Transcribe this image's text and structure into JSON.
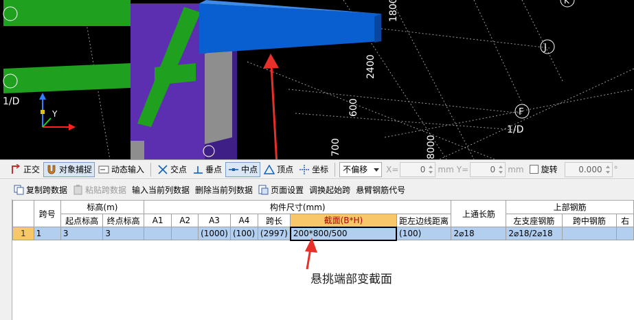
{
  "viewport": {
    "axis_labels": [
      "1/D",
      "1/D",
      "J",
      "F",
      "K"
    ],
    "dimension_labels": [
      "1800",
      "2400",
      "600",
      "700",
      "8000"
    ],
    "axis_letters": {
      "y": "Y"
    }
  },
  "snap_toolbar": {
    "ortho": "正交",
    "object_snap": "对象捕捉",
    "dynamic_input": "动态输入",
    "intersection": "交点",
    "perpendicular": "垂点",
    "midpoint": "中点",
    "vertex": "顶点",
    "coordinate": "坐标",
    "offset_value": "不偏移",
    "x_label": "X=",
    "x_value": "0",
    "x_unit": "mm",
    "y_label": "Y=",
    "y_value": "0",
    "y_unit": "mm",
    "rotate_label": "旋转",
    "rotate_value": "0.000",
    "degree": "°"
  },
  "grid_toolbar": {
    "copy_span": "复制跨数据",
    "paste_span": "粘贴跨数据",
    "input_column": "输入当前列数据",
    "delete_column": "删除当前列数据",
    "page_setup": "页面设置",
    "swap_start": "调换起始跨",
    "cantilever_code": "悬臂钢筋代号"
  },
  "table": {
    "headers": {
      "span_no": "跨号",
      "elevation": "标高(m)",
      "start_elev": "起点标高",
      "end_elev": "终点标高",
      "member_size": "构件尺寸(mm)",
      "a1": "A1",
      "a2": "A2",
      "a3": "A3",
      "a4": "A4",
      "span_len": "跨长",
      "section": "截面(B*H)",
      "dist_left": "距左边线距离",
      "top_through": "上通长筋",
      "top_rebar": "上部钢筋",
      "left_support": "左支座钢筋",
      "mid_span": "跨中钢筋",
      "right": "右"
    },
    "rows": [
      {
        "rownum": "1",
        "span_no": "1",
        "start_elev": "3",
        "end_elev": "3",
        "a1": "",
        "a2": "",
        "a3": "(1000)",
        "a4": "(100)",
        "span_len": "(2997)",
        "section": "200*800/500",
        "dist_left": "(100)",
        "top_through": "2⌀18",
        "left_support": "2⌀18/2⌀18",
        "mid_span": "",
        "right": ""
      }
    ]
  },
  "annotation": {
    "text": "悬挑端部变截面"
  },
  "colors": {
    "beam_blue": "#0a5fd0",
    "beam_green": "#1fa01f",
    "column_purple": "#5b2fb0",
    "arrow_red": "#e8302a",
    "selection_blue": "#b3cff0",
    "active_header": "#f7c76a"
  }
}
